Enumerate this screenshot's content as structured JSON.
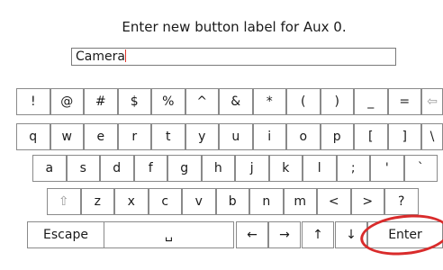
{
  "dialog": {
    "title": "Enter new button label for Aux 0.",
    "input_value": "Camera"
  },
  "keyboard": {
    "rows": [
      {
        "keys": [
          {
            "label": "!",
            "name": "key-exclaim"
          },
          {
            "label": "@",
            "name": "key-at"
          },
          {
            "label": "#",
            "name": "key-hash"
          },
          {
            "label": "$",
            "name": "key-dollar"
          },
          {
            "label": "%",
            "name": "key-percent"
          },
          {
            "label": "^",
            "name": "key-caret"
          },
          {
            "label": "&",
            "name": "key-ampersand"
          },
          {
            "label": "*",
            "name": "key-asterisk"
          },
          {
            "label": "(",
            "name": "key-left-paren"
          },
          {
            "label": ")",
            "name": "key-right-paren"
          },
          {
            "label": "_",
            "name": "key-underscore"
          },
          {
            "label": "=",
            "name": "key-equals"
          },
          {
            "label": "⇦",
            "name": "backspace-icon",
            "dim": true
          }
        ]
      },
      {
        "keys": [
          {
            "label": "q",
            "name": "key-q"
          },
          {
            "label": "w",
            "name": "key-w"
          },
          {
            "label": "e",
            "name": "key-e"
          },
          {
            "label": "r",
            "name": "key-r"
          },
          {
            "label": "t",
            "name": "key-t"
          },
          {
            "label": "y",
            "name": "key-y"
          },
          {
            "label": "u",
            "name": "key-u"
          },
          {
            "label": "i",
            "name": "key-i"
          },
          {
            "label": "o",
            "name": "key-o"
          },
          {
            "label": "p",
            "name": "key-p"
          },
          {
            "label": "[",
            "name": "key-left-bracket"
          },
          {
            "label": "]",
            "name": "key-right-bracket"
          },
          {
            "label": "\\",
            "name": "key-backslash"
          }
        ]
      },
      {
        "keys": [
          {
            "label": "a",
            "name": "key-a"
          },
          {
            "label": "s",
            "name": "key-s"
          },
          {
            "label": "d",
            "name": "key-d"
          },
          {
            "label": "f",
            "name": "key-f"
          },
          {
            "label": "g",
            "name": "key-g"
          },
          {
            "label": "h",
            "name": "key-h"
          },
          {
            "label": "j",
            "name": "key-j"
          },
          {
            "label": "k",
            "name": "key-k"
          },
          {
            "label": "l",
            "name": "key-l"
          },
          {
            "label": ";",
            "name": "key-semicolon"
          },
          {
            "label": "'",
            "name": "key-apostrophe"
          },
          {
            "label": "`",
            "name": "key-backtick"
          }
        ]
      },
      {
        "keys": [
          {
            "label": "⇧",
            "name": "shift-icon",
            "dim": true
          },
          {
            "label": "z",
            "name": "key-z"
          },
          {
            "label": "x",
            "name": "key-x"
          },
          {
            "label": "c",
            "name": "key-c"
          },
          {
            "label": "v",
            "name": "key-v"
          },
          {
            "label": "b",
            "name": "key-b"
          },
          {
            "label": "n",
            "name": "key-n"
          },
          {
            "label": "m",
            "name": "key-m"
          },
          {
            "label": "<",
            "name": "key-less-than"
          },
          {
            "label": ">",
            "name": "key-greater-than"
          },
          {
            "label": "?",
            "name": "key-question"
          }
        ]
      },
      {
        "keys": [
          {
            "label": "Escape",
            "name": "escape-button"
          },
          {
            "label": "␣",
            "name": "space-bar"
          },
          {
            "label": "←",
            "name": "arrow-left-icon"
          },
          {
            "label": "→",
            "name": "arrow-right-icon"
          },
          {
            "label": "↑",
            "name": "arrow-up-icon"
          },
          {
            "label": "↓",
            "name": "arrow-down-icon"
          },
          {
            "label": "Enter",
            "name": "enter-button"
          }
        ]
      }
    ]
  },
  "colors": {
    "annotation_circle": "#d92b2b",
    "caret": "#e0362c"
  }
}
